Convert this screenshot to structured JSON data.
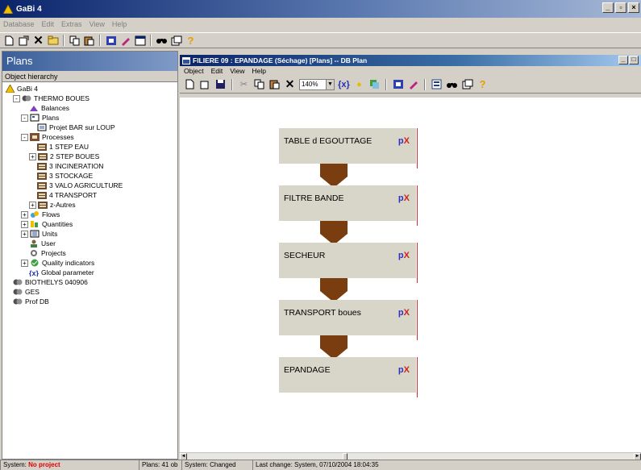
{
  "app": {
    "title": "GaBi 4"
  },
  "menubar": [
    "Database",
    "Edit",
    "Extras",
    "View",
    "Help"
  ],
  "toolbar_icons": [
    "new-icon",
    "properties-icon",
    "delete-icon",
    "folder-icon",
    "copy-icon",
    "paste-icon",
    "process-icon",
    "edit-icon",
    "window-icon",
    "find-icon",
    "window2-icon",
    "help-icon"
  ],
  "left": {
    "header": "Plans",
    "subheader": "Object hierarchy",
    "tree": [
      {
        "label": "GaBi 4",
        "indent": 0,
        "pm": "",
        "icon": "gabi-icon"
      },
      {
        "label": "THERMO BOUES",
        "indent": 1,
        "pm": "-",
        "icon": "database-icon"
      },
      {
        "label": "Balances",
        "indent": 3,
        "pm": "",
        "icon": "balance-icon"
      },
      {
        "label": "Plans",
        "indent": 2,
        "pm": "-",
        "icon": "plans-icon"
      },
      {
        "label": "Projet BAR sur LOUP",
        "indent": 4,
        "pm": "",
        "icon": "plan-icon"
      },
      {
        "label": "Processes",
        "indent": 2,
        "pm": "-",
        "icon": "processes-icon"
      },
      {
        "label": "1 STEP EAU",
        "indent": 4,
        "pm": "",
        "icon": "folder-icon"
      },
      {
        "label": "2 STEP BOUES",
        "indent": 3,
        "pm": "+",
        "icon": "folder-icon"
      },
      {
        "label": "3 INCINERATION",
        "indent": 4,
        "pm": "",
        "icon": "folder-icon"
      },
      {
        "label": "3 STOCKAGE",
        "indent": 4,
        "pm": "",
        "icon": "folder-icon"
      },
      {
        "label": "3 VALO AGRICULTURE",
        "indent": 4,
        "pm": "",
        "icon": "folder-icon"
      },
      {
        "label": "4 TRANSPORT",
        "indent": 4,
        "pm": "",
        "icon": "folder-icon"
      },
      {
        "label": "z-Autres",
        "indent": 3,
        "pm": "+",
        "icon": "folder-icon"
      },
      {
        "label": "Flows",
        "indent": 2,
        "pm": "+",
        "icon": "flows-icon"
      },
      {
        "label": "Quantities",
        "indent": 2,
        "pm": "+",
        "icon": "quantities-icon"
      },
      {
        "label": "Units",
        "indent": 2,
        "pm": "+",
        "icon": "units-icon"
      },
      {
        "label": "User",
        "indent": 3,
        "pm": "",
        "icon": "user-icon"
      },
      {
        "label": "Projects",
        "indent": 3,
        "pm": "",
        "icon": "projects-icon"
      },
      {
        "label": "Quality indicators",
        "indent": 2,
        "pm": "+",
        "icon": "quality-icon"
      },
      {
        "label": "Global parameter",
        "indent": 3,
        "pm": "",
        "icon": "parameter-icon"
      },
      {
        "label": "BIOTHELYS 040906",
        "indent": 1,
        "pm": "",
        "icon": "database-icon"
      },
      {
        "label": "GES",
        "indent": 1,
        "pm": "",
        "icon": "database-icon"
      },
      {
        "label": "Prof DB",
        "indent": 1,
        "pm": "",
        "icon": "database-icon"
      }
    ]
  },
  "child": {
    "title": "FILIERE 09 : EPANDAGE (Séchage) [Plans] -- DB Plan",
    "menu": [
      "Object",
      "Edit",
      "View",
      "Help"
    ],
    "zoom": "140%"
  },
  "plan": {
    "boxes": [
      {
        "label": "TABLE d EGOUTTAGE"
      },
      {
        "label": "FILTRE BANDE"
      },
      {
        "label": "SECHEUR"
      },
      {
        "label": "TRANSPORT boues"
      },
      {
        "label": "EPANDAGE"
      }
    ],
    "box_marker_p": "p",
    "box_marker_x": "X",
    "arrow_color": "#7a3d10",
    "box_color": "#d8d6c8"
  },
  "status": {
    "system_label": "System:",
    "system_value": "No project",
    "plans_count": "Plans: 41 ob",
    "system_changed": "System: Changed",
    "last_change": "Last change: System, 07/10/2004 18:04:35"
  }
}
